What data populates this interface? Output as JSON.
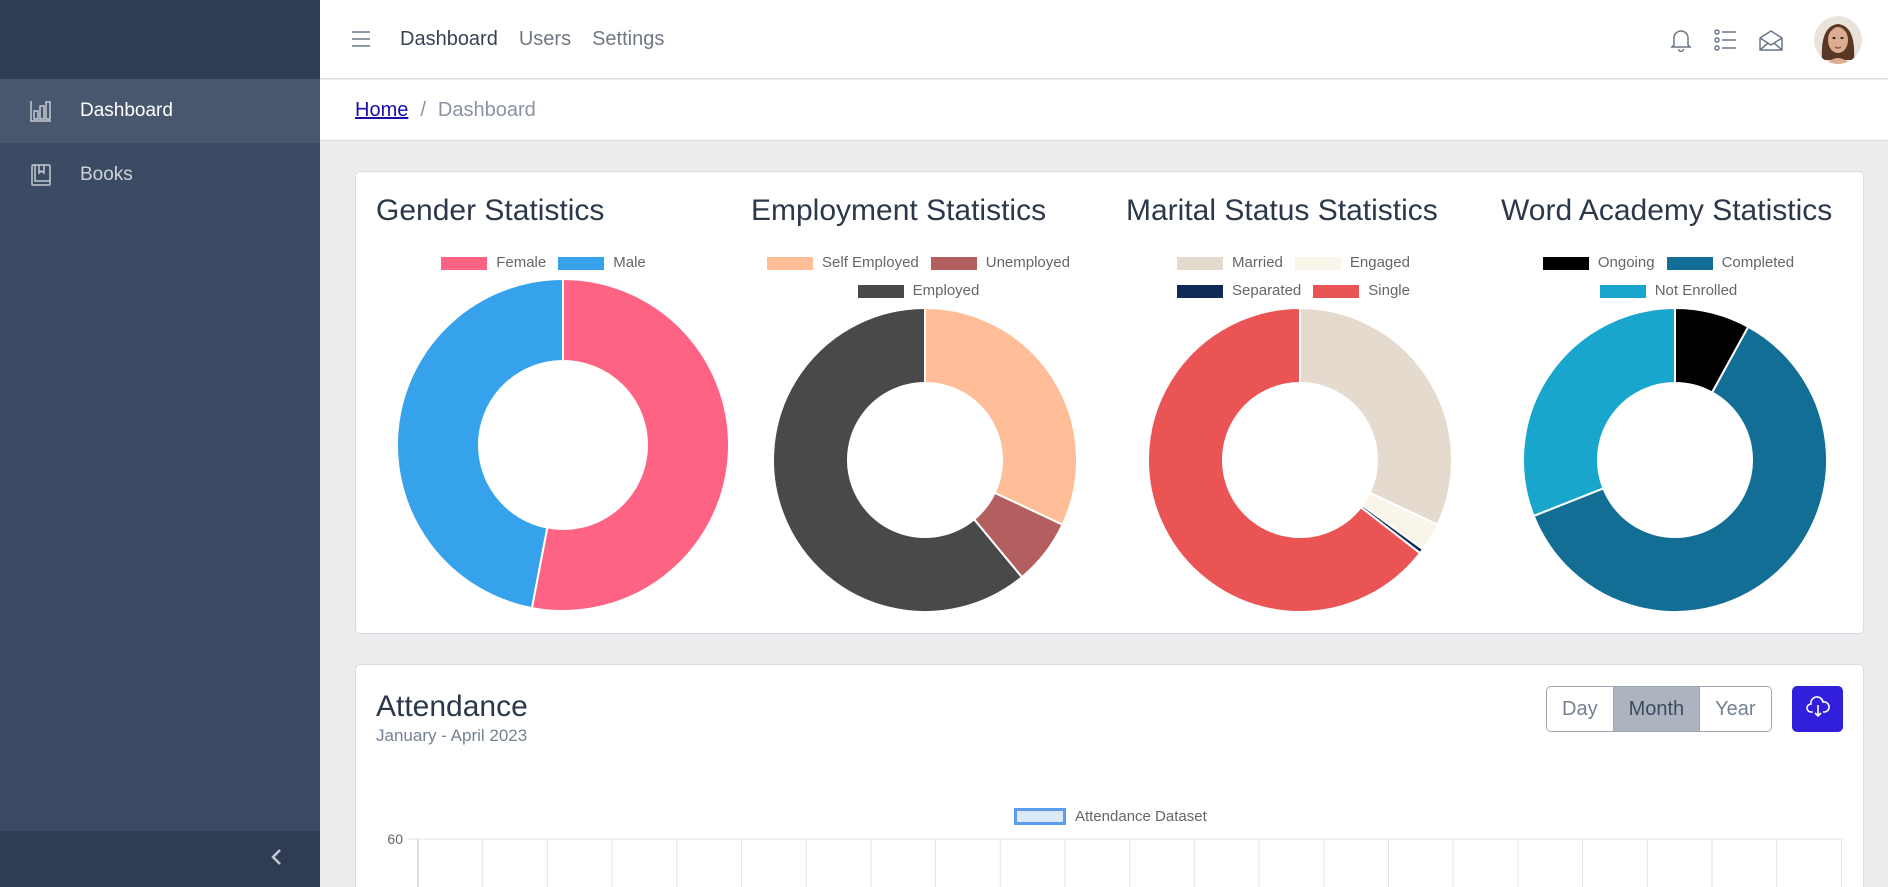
{
  "sidebar": {
    "items": [
      {
        "label": "Dashboard",
        "icon": "bar-chart-icon",
        "active": true
      },
      {
        "label": "Books",
        "icon": "book-icon",
        "active": false
      }
    ],
    "toggler_icon": "chevron-left-icon"
  },
  "header": {
    "menu_icon": "hamburger-icon",
    "nav": [
      {
        "label": "Dashboard",
        "active": true
      },
      {
        "label": "Users",
        "active": false
      },
      {
        "label": "Settings",
        "active": false
      }
    ],
    "icons": [
      "bell-icon",
      "list-icon",
      "envelope-icon"
    ]
  },
  "breadcrumb": {
    "home": "Home",
    "separator": "/",
    "current": "Dashboard"
  },
  "stats": [
    {
      "title": "Gender Statistics",
      "chart_data": {
        "type": "pie",
        "categories": [
          "Female",
          "Male"
        ],
        "values": [
          53,
          47
        ],
        "colors": [
          "#ff6384",
          "#36a2eb"
        ]
      }
    },
    {
      "title": "Employment Statistics",
      "chart_data": {
        "type": "pie",
        "categories": [
          "Self Employed",
          "Unemployed",
          "Employed"
        ],
        "values": [
          32,
          7,
          61
        ],
        "colors": [
          "#ffbd98",
          "#b35f5f",
          "#494949"
        ]
      }
    },
    {
      "title": "Marital Status Statistics",
      "chart_data": {
        "type": "pie",
        "categories": [
          "Married",
          "Engaged",
          "Separated",
          "Single"
        ],
        "values": [
          32,
          3,
          0.5,
          64.5
        ],
        "colors": [
          "#e4dbce",
          "#faf5e9",
          "#0e2a55",
          "#ea5455"
        ]
      }
    },
    {
      "title": "Word Academy Statistics",
      "chart_data": {
        "type": "pie",
        "categories": [
          "Ongoing",
          "Completed",
          "Not Enrolled"
        ],
        "values": [
          8,
          61,
          31
        ],
        "colors": [
          "#000000",
          "#136e96",
          "#19a6cc"
        ]
      }
    }
  ],
  "attendance": {
    "title": "Attendance",
    "subtitle": "January - April 2023",
    "buttons": [
      "Day",
      "Month",
      "Year"
    ],
    "active_button": "Month",
    "download_icon": "cloud-download-icon",
    "chart_data": {
      "type": "bar",
      "series": [
        {
          "name": "Attendance Dataset",
          "values": []
        }
      ],
      "y_ticks": [
        "60"
      ],
      "grid": true
    }
  }
}
